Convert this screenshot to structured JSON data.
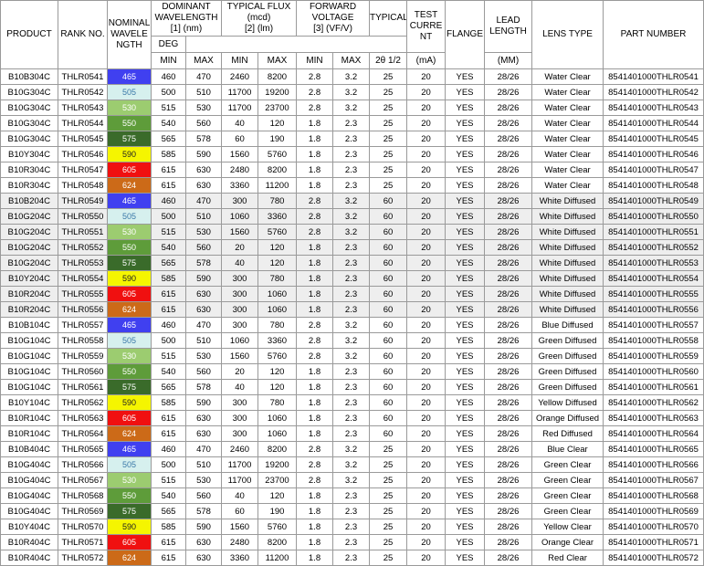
{
  "headers": {
    "product": "PRODUCT",
    "rank": "RANK NO.",
    "nominal": [
      "NOMINAL",
      "WAVELE",
      "NGTH"
    ],
    "dominant": [
      "DOMINANT",
      "WAVELENGTH"
    ],
    "dominant_unit": "[1] (nm)",
    "flux": "TYPICAL FLUX",
    "flux_sub": "(mcd)",
    "flux_unit": "[2] (lm)",
    "forward": [
      "FORWARD",
      "VOLTAGE"
    ],
    "forward_unit": "[3] (VF/V)",
    "typical": "TYPICAL",
    "typical_unit": "DEG",
    "typical_angle": "2θ 1/2",
    "test": [
      "TEST",
      "CURRE",
      "NT"
    ],
    "test_unit": "(mA)",
    "flange": "FLANGE",
    "lead": [
      "LEAD",
      "LENGTH"
    ],
    "lead_unit": "(MM)",
    "lens": "LENS TYPE",
    "part": "PART NUMBER",
    "min": "MIN",
    "max": "MAX"
  },
  "colors": {
    "465": "#4040f0",
    "505": "#d6f0ee",
    "530": "#9ccc70",
    "550": "#5e9c3a",
    "575": "#3a6b2a",
    "590": "#f5f500",
    "605": "#f01010",
    "624": "#cc6a18"
  },
  "rows": [
    {
      "product": "B10B304C",
      "rank": "THLR0541",
      "wl": "465",
      "dmin": "460",
      "dmax": "470",
      "fmin": "2460",
      "fmax": "8200",
      "vmin": "2.8",
      "vmax": "3.2",
      "deg": "25",
      "ma": "20",
      "flange": "YES",
      "lead": "28/26",
      "lens": "Water Clear",
      "part": "8541401000THLR0541"
    },
    {
      "product": "B10G304C",
      "rank": "THLR0542",
      "wl": "505",
      "dmin": "500",
      "dmax": "510",
      "fmin": "11700",
      "fmax": "19200",
      "vmin": "2.8",
      "vmax": "3.2",
      "deg": "25",
      "ma": "20",
      "flange": "YES",
      "lead": "28/26",
      "lens": "Water Clear",
      "part": "8541401000THLR0542"
    },
    {
      "product": "B10G304C",
      "rank": "THLR0543",
      "wl": "530",
      "dmin": "515",
      "dmax": "530",
      "fmin": "11700",
      "fmax": "23700",
      "vmin": "2.8",
      "vmax": "3.2",
      "deg": "25",
      "ma": "20",
      "flange": "YES",
      "lead": "28/26",
      "lens": "Water Clear",
      "part": "8541401000THLR0543"
    },
    {
      "product": "B10G304C",
      "rank": "THLR0544",
      "wl": "550",
      "dmin": "540",
      "dmax": "560",
      "fmin": "40",
      "fmax": "120",
      "vmin": "1.8",
      "vmax": "2.3",
      "deg": "25",
      "ma": "20",
      "flange": "YES",
      "lead": "28/26",
      "lens": "Water Clear",
      "part": "8541401000THLR0544"
    },
    {
      "product": "B10G304C",
      "rank": "THLR0545",
      "wl": "575",
      "dmin": "565",
      "dmax": "578",
      "fmin": "60",
      "fmax": "190",
      "vmin": "1.8",
      "vmax": "2.3",
      "deg": "25",
      "ma": "20",
      "flange": "YES",
      "lead": "28/26",
      "lens": "Water Clear",
      "part": "8541401000THLR0545"
    },
    {
      "product": "B10Y304C",
      "rank": "THLR0546",
      "wl": "590",
      "dmin": "585",
      "dmax": "590",
      "fmin": "1560",
      "fmax": "5760",
      "vmin": "1.8",
      "vmax": "2.3",
      "deg": "25",
      "ma": "20",
      "flange": "YES",
      "lead": "28/26",
      "lens": "Water Clear",
      "part": "8541401000THLR0546"
    },
    {
      "product": "B10R304C",
      "rank": "THLR0547",
      "wl": "605",
      "dmin": "615",
      "dmax": "630",
      "fmin": "2480",
      "fmax": "8200",
      "vmin": "1.8",
      "vmax": "2.3",
      "deg": "25",
      "ma": "20",
      "flange": "YES",
      "lead": "28/26",
      "lens": "Water Clear",
      "part": "8541401000THLR0547"
    },
    {
      "product": "B10R304C",
      "rank": "THLR0548",
      "wl": "624",
      "dmin": "615",
      "dmax": "630",
      "fmin": "3360",
      "fmax": "11200",
      "vmin": "1.8",
      "vmax": "2.3",
      "deg": "25",
      "ma": "20",
      "flange": "YES",
      "lead": "28/26",
      "lens": "Water Clear",
      "part": "8541401000THLR0548"
    },
    {
      "product": "B10B204C",
      "rank": "THLR0549",
      "wl": "465",
      "dmin": "460",
      "dmax": "470",
      "fmin": "300",
      "fmax": "780",
      "vmin": "2.8",
      "vmax": "3.2",
      "deg": "60",
      "ma": "20",
      "flange": "YES",
      "lead": "28/26",
      "lens": "White Diffused",
      "part": "8541401000THLR0549"
    },
    {
      "product": "B10G204C",
      "rank": "THLR0550",
      "wl": "505",
      "dmin": "500",
      "dmax": "510",
      "fmin": "1060",
      "fmax": "3360",
      "vmin": "2.8",
      "vmax": "3.2",
      "deg": "60",
      "ma": "20",
      "flange": "YES",
      "lead": "28/26",
      "lens": "White Diffused",
      "part": "8541401000THLR0550"
    },
    {
      "product": "B10G204C",
      "rank": "THLR0551",
      "wl": "530",
      "dmin": "515",
      "dmax": "530",
      "fmin": "1560",
      "fmax": "5760",
      "vmin": "2.8",
      "vmax": "3.2",
      "deg": "60",
      "ma": "20",
      "flange": "YES",
      "lead": "28/26",
      "lens": "White Diffused",
      "part": "8541401000THLR0551"
    },
    {
      "product": "B10G204C",
      "rank": "THLR0552",
      "wl": "550",
      "dmin": "540",
      "dmax": "560",
      "fmin": "20",
      "fmax": "120",
      "vmin": "1.8",
      "vmax": "2.3",
      "deg": "60",
      "ma": "20",
      "flange": "YES",
      "lead": "28/26",
      "lens": "White Diffused",
      "part": "8541401000THLR0552"
    },
    {
      "product": "B10G204C",
      "rank": "THLR0553",
      "wl": "575",
      "dmin": "565",
      "dmax": "578",
      "fmin": "40",
      "fmax": "120",
      "vmin": "1.8",
      "vmax": "2.3",
      "deg": "60",
      "ma": "20",
      "flange": "YES",
      "lead": "28/26",
      "lens": "White Diffused",
      "part": "8541401000THLR0553"
    },
    {
      "product": "B10Y204C",
      "rank": "THLR0554",
      "wl": "590",
      "dmin": "585",
      "dmax": "590",
      "fmin": "300",
      "fmax": "780",
      "vmin": "1.8",
      "vmax": "2.3",
      "deg": "60",
      "ma": "20",
      "flange": "YES",
      "lead": "28/26",
      "lens": "White Diffused",
      "part": "8541401000THLR0554"
    },
    {
      "product": "B10R204C",
      "rank": "THLR0555",
      "wl": "605",
      "dmin": "615",
      "dmax": "630",
      "fmin": "300",
      "fmax": "1060",
      "vmin": "1.8",
      "vmax": "2.3",
      "deg": "60",
      "ma": "20",
      "flange": "YES",
      "lead": "28/26",
      "lens": "White Diffused",
      "part": "8541401000THLR0555"
    },
    {
      "product": "B10R204C",
      "rank": "THLR0556",
      "wl": "624",
      "dmin": "615",
      "dmax": "630",
      "fmin": "300",
      "fmax": "1060",
      "vmin": "1.8",
      "vmax": "2.3",
      "deg": "60",
      "ma": "20",
      "flange": "YES",
      "lead": "28/26",
      "lens": "White Diffused",
      "part": "8541401000THLR0556"
    },
    {
      "product": "B10B104C",
      "rank": "THLR0557",
      "wl": "465",
      "dmin": "460",
      "dmax": "470",
      "fmin": "300",
      "fmax": "780",
      "vmin": "2.8",
      "vmax": "3.2",
      "deg": "60",
      "ma": "20",
      "flange": "YES",
      "lead": "28/26",
      "lens": "Blue Diffused",
      "part": "8541401000THLR0557"
    },
    {
      "product": "B10G104C",
      "rank": "THLR0558",
      "wl": "505",
      "dmin": "500",
      "dmax": "510",
      "fmin": "1060",
      "fmax": "3360",
      "vmin": "2.8",
      "vmax": "3.2",
      "deg": "60",
      "ma": "20",
      "flange": "YES",
      "lead": "28/26",
      "lens": "Green Diffused",
      "part": "8541401000THLR0558"
    },
    {
      "product": "B10G104C",
      "rank": "THLR0559",
      "wl": "530",
      "dmin": "515",
      "dmax": "530",
      "fmin": "1560",
      "fmax": "5760",
      "vmin": "2.8",
      "vmax": "3.2",
      "deg": "60",
      "ma": "20",
      "flange": "YES",
      "lead": "28/26",
      "lens": "Green Diffused",
      "part": "8541401000THLR0559"
    },
    {
      "product": "B10G104C",
      "rank": "THLR0560",
      "wl": "550",
      "dmin": "540",
      "dmax": "560",
      "fmin": "20",
      "fmax": "120",
      "vmin": "1.8",
      "vmax": "2.3",
      "deg": "60",
      "ma": "20",
      "flange": "YES",
      "lead": "28/26",
      "lens": "Green Diffused",
      "part": "8541401000THLR0560"
    },
    {
      "product": "B10G104C",
      "rank": "THLR0561",
      "wl": "575",
      "dmin": "565",
      "dmax": "578",
      "fmin": "40",
      "fmax": "120",
      "vmin": "1.8",
      "vmax": "2.3",
      "deg": "60",
      "ma": "20",
      "flange": "YES",
      "lead": "28/26",
      "lens": "Green Diffused",
      "part": "8541401000THLR0561"
    },
    {
      "product": "B10Y104C",
      "rank": "THLR0562",
      "wl": "590",
      "dmin": "585",
      "dmax": "590",
      "fmin": "300",
      "fmax": "780",
      "vmin": "1.8",
      "vmax": "2.3",
      "deg": "60",
      "ma": "20",
      "flange": "YES",
      "lead": "28/26",
      "lens": "Yellow Diffused",
      "part": "8541401000THLR0562"
    },
    {
      "product": "B10R104C",
      "rank": "THLR0563",
      "wl": "605",
      "dmin": "615",
      "dmax": "630",
      "fmin": "300",
      "fmax": "1060",
      "vmin": "1.8",
      "vmax": "2.3",
      "deg": "60",
      "ma": "20",
      "flange": "YES",
      "lead": "28/26",
      "lens": "Orange Diffused",
      "part": "8541401000THLR0563"
    },
    {
      "product": "B10R104C",
      "rank": "THLR0564",
      "wl": "624",
      "dmin": "615",
      "dmax": "630",
      "fmin": "300",
      "fmax": "1060",
      "vmin": "1.8",
      "vmax": "2.3",
      "deg": "60",
      "ma": "20",
      "flange": "YES",
      "lead": "28/26",
      "lens": "Red Diffused",
      "part": "8541401000THLR0564"
    },
    {
      "product": "B10B404C",
      "rank": "THLR0565",
      "wl": "465",
      "dmin": "460",
      "dmax": "470",
      "fmin": "2460",
      "fmax": "8200",
      "vmin": "2.8",
      "vmax": "3.2",
      "deg": "25",
      "ma": "20",
      "flange": "YES",
      "lead": "28/26",
      "lens": "Blue Clear",
      "part": "8541401000THLR0565"
    },
    {
      "product": "B10G404C",
      "rank": "THLR0566",
      "wl": "505",
      "dmin": "500",
      "dmax": "510",
      "fmin": "11700",
      "fmax": "19200",
      "vmin": "2.8",
      "vmax": "3.2",
      "deg": "25",
      "ma": "20",
      "flange": "YES",
      "lead": "28/26",
      "lens": "Green Clear",
      "part": "8541401000THLR0566"
    },
    {
      "product": "B10G404C",
      "rank": "THLR0567",
      "wl": "530",
      "dmin": "515",
      "dmax": "530",
      "fmin": "11700",
      "fmax": "23700",
      "vmin": "2.8",
      "vmax": "3.2",
      "deg": "25",
      "ma": "20",
      "flange": "YES",
      "lead": "28/26",
      "lens": "Green Clear",
      "part": "8541401000THLR0567"
    },
    {
      "product": "B10G404C",
      "rank": "THLR0568",
      "wl": "550",
      "dmin": "540",
      "dmax": "560",
      "fmin": "40",
      "fmax": "120",
      "vmin": "1.8",
      "vmax": "2.3",
      "deg": "25",
      "ma": "20",
      "flange": "YES",
      "lead": "28/26",
      "lens": "Green Clear",
      "part": "8541401000THLR0568"
    },
    {
      "product": "B10G404C",
      "rank": "THLR0569",
      "wl": "575",
      "dmin": "565",
      "dmax": "578",
      "fmin": "60",
      "fmax": "190",
      "vmin": "1.8",
      "vmax": "2.3",
      "deg": "25",
      "ma": "20",
      "flange": "YES",
      "lead": "28/26",
      "lens": "Green Clear",
      "part": "8541401000THLR0569"
    },
    {
      "product": "B10Y404C",
      "rank": "THLR0570",
      "wl": "590",
      "dmin": "585",
      "dmax": "590",
      "fmin": "1560",
      "fmax": "5760",
      "vmin": "1.8",
      "vmax": "2.3",
      "deg": "25",
      "ma": "20",
      "flange": "YES",
      "lead": "28/26",
      "lens": "Yellow Clear",
      "part": "8541401000THLR0570"
    },
    {
      "product": "B10R404C",
      "rank": "THLR0571",
      "wl": "605",
      "dmin": "615",
      "dmax": "630",
      "fmin": "2480",
      "fmax": "8200",
      "vmin": "1.8",
      "vmax": "2.3",
      "deg": "25",
      "ma": "20",
      "flange": "YES",
      "lead": "28/26",
      "lens": "Orange Clear",
      "part": "8541401000THLR0571"
    },
    {
      "product": "B10R404C",
      "rank": "THLR0572",
      "wl": "624",
      "dmin": "615",
      "dmax": "630",
      "fmin": "3360",
      "fmax": "11200",
      "vmin": "1.8",
      "vmax": "2.3",
      "deg": "25",
      "ma": "20",
      "flange": "YES",
      "lead": "28/26",
      "lens": "Red Clear",
      "part": "8541401000THLR0572"
    }
  ]
}
